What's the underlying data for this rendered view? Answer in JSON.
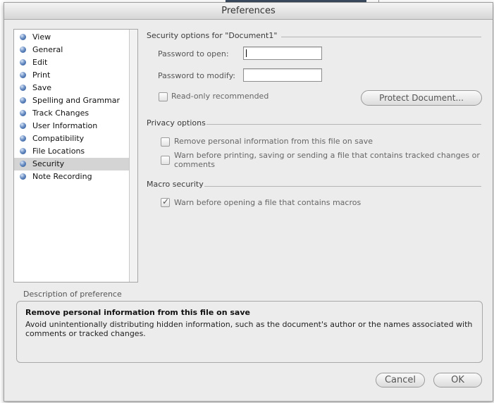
{
  "window": {
    "title": "Preferences"
  },
  "sidebar": {
    "items": [
      {
        "label": "View"
      },
      {
        "label": "General"
      },
      {
        "label": "Edit"
      },
      {
        "label": "Print"
      },
      {
        "label": "Save"
      },
      {
        "label": "Spelling and Grammar"
      },
      {
        "label": "Track Changes"
      },
      {
        "label": "User Information"
      },
      {
        "label": "Compatibility"
      },
      {
        "label": "File Locations"
      },
      {
        "label": "Security",
        "selected": true
      },
      {
        "label": "Note Recording"
      }
    ]
  },
  "security": {
    "section_title": "Security options for \"Document1\"",
    "password_open_label": "Password to open:",
    "password_open_value": "",
    "password_modify_label": "Password to modify:",
    "password_modify_value": "",
    "readonly_label": "Read-only recommended",
    "readonly_checked": false,
    "protect_button": "Protect Document..."
  },
  "privacy": {
    "section_title": "Privacy options",
    "remove_info_label": "Remove personal information from this file on save",
    "remove_info_checked": false,
    "warn_tracked_label_line1": "Warn before printing, saving or sending a file that contains tracked changes or",
    "warn_tracked_label_line2": "comments",
    "warn_tracked_checked": false
  },
  "macro": {
    "section_title": "Macro security",
    "warn_macros_label": "Warn before opening a file that contains macros",
    "warn_macros_checked": true
  },
  "description": {
    "section_title": "Description of preference",
    "heading": "Remove personal information from this file on save",
    "body": "Avoid unintentionally distributing hidden information, such as the document's author or the names associated with comments or tracked changes."
  },
  "buttons": {
    "cancel": "Cancel",
    "ok": "OK"
  }
}
